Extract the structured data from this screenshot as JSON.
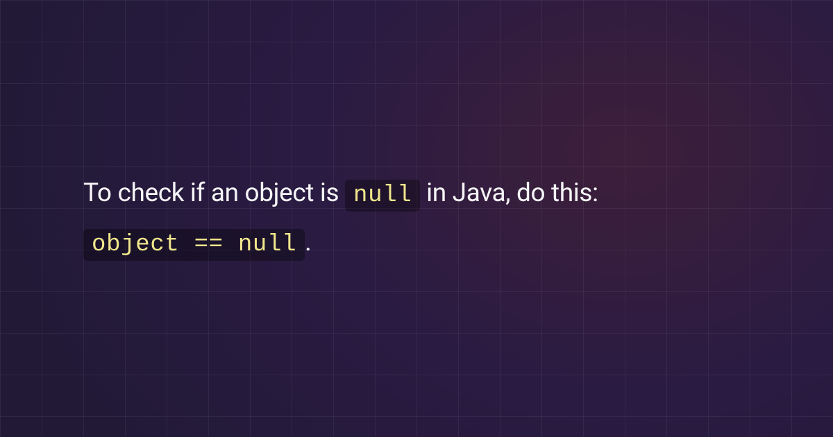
{
  "content": {
    "text_before_code1": "To check if an object is ",
    "code1": "null",
    "text_between": " in Java, do this: ",
    "code2": "object == null",
    "text_after": "."
  },
  "colors": {
    "background_dark": "#221937",
    "background_purple": "#2a1b42",
    "background_magenta": "#3d1f3a",
    "text": "#f5f5f7",
    "code_text": "#f0e68c",
    "code_bg": "rgba(0, 0, 0, 0.32)",
    "grid_line": "rgba(255, 255, 255, 0.055)"
  }
}
